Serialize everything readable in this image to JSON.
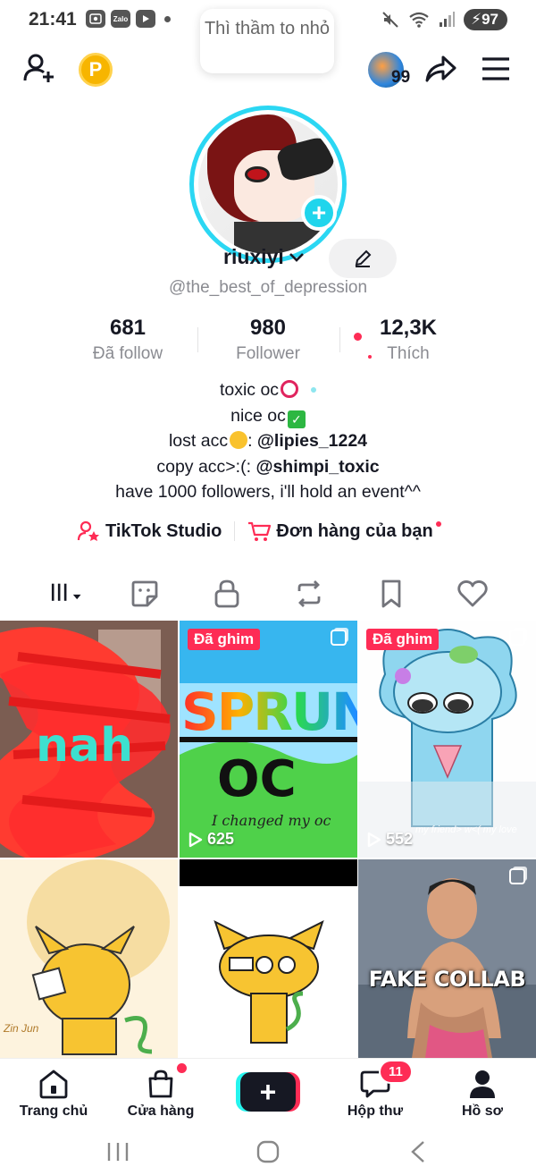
{
  "status_bar": {
    "time": "21:41",
    "battery": "97",
    "left_icons": [
      "gallery-icon",
      "zalo-icon",
      "youtube-icon"
    ],
    "zalo_label": "Zalo"
  },
  "header": {
    "tooltip": "Thì thầm to nhỏ",
    "coin_letter": "P",
    "friends_count": "99"
  },
  "profile": {
    "username": "riuxiyi",
    "handle": "@the_best_of_depression"
  },
  "stats": [
    {
      "value": "681",
      "label": "Đã follow"
    },
    {
      "value": "980",
      "label": "Follower"
    },
    {
      "value": "12,3K",
      "label": "Thích"
    }
  ],
  "bio": {
    "line1": "toxic oc",
    "line2": "nice oc",
    "line3_prefix": "lost acc",
    "line3_handle": "@lipies_1224",
    "line4_prefix": "copy acc>:(: ",
    "line4_handle": "@shimpi_toxic",
    "line5": "have 1000 followers, i'll hold an event^^"
  },
  "links": {
    "studio": "TikTok Studio",
    "orders": "Đơn hàng của bạn"
  },
  "grid": {
    "items": [
      {
        "pinned": false,
        "views": "",
        "scribble_text": "nah"
      },
      {
        "pinned": true,
        "pin_label": "Đã ghim",
        "views": "625",
        "title_word": "SPRUNK",
        "subtitle": "OC",
        "caption": "I changed my oc"
      },
      {
        "pinned": true,
        "pin_label": "Đã ghim",
        "views": "552",
        "caption": "my friend> w<( my love"
      },
      {
        "pinned": false,
        "views": "",
        "caption": "Zin Jun"
      },
      {
        "pinned": false,
        "views": ""
      },
      {
        "pinned": false,
        "views": "",
        "caption": "FAKE COLLAB"
      }
    ]
  },
  "bottom_nav": {
    "home": "Trang chủ",
    "shop": "Cửa hàng",
    "create": "+",
    "inbox": "Hộp thư",
    "inbox_badge": "11",
    "profile": "Hồ sơ"
  },
  "colors": {
    "accent": "#fe2c55",
    "cyan": "#20d5ec",
    "text": "#161823",
    "muted": "#8a8b91"
  }
}
